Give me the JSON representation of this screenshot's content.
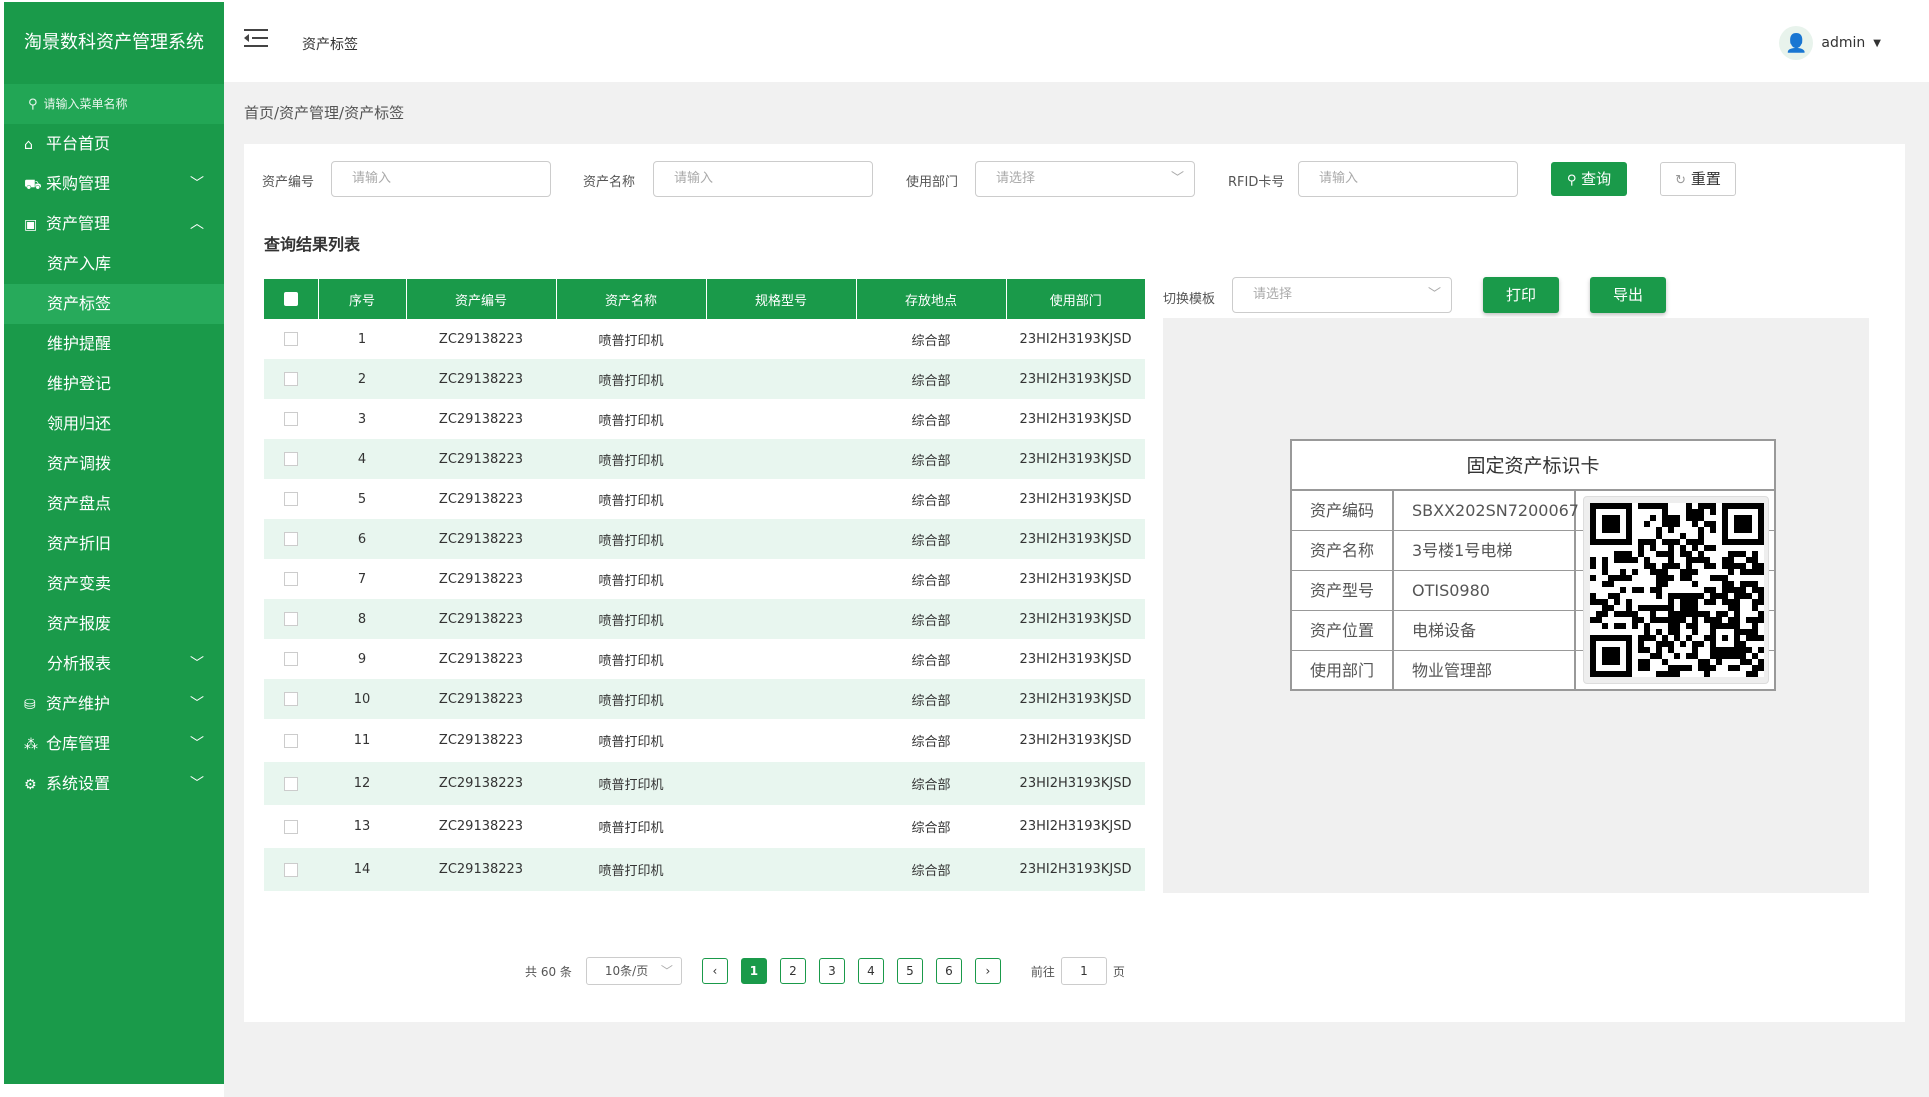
{
  "colors": {
    "brand": "#1a9a4a",
    "row_alt": "#e8f6ef"
  },
  "app": {
    "title": "淘景数科资产管理系统"
  },
  "sidebar": {
    "search_placeholder": "请输入菜单名称",
    "menu": [
      {
        "label": "平台首页",
        "icon": "home-icon"
      },
      {
        "label": "采购管理",
        "icon": "cart-icon",
        "expanded": false
      },
      {
        "label": "资产管理",
        "icon": "monitor-icon",
        "expanded": true
      }
    ],
    "asset_submenu": [
      "资产入库",
      "资产标签",
      "维护提醒",
      "维护登记",
      "领用归还",
      "资产调拨",
      "资产盘点",
      "资产折旧",
      "资产变卖",
      "资产报废",
      "分析报表"
    ],
    "active_submenu": "资产标签",
    "menu_after": [
      {
        "label": "资产维护",
        "icon": "database-icon"
      },
      {
        "label": "仓库管理",
        "icon": "warehouse-icon"
      },
      {
        "label": "系统设置",
        "icon": "gear-icon"
      }
    ]
  },
  "header": {
    "page_title": "资产标签",
    "user": "admin"
  },
  "breadcrumb": "首页/资产管理/资产标签",
  "filters": {
    "asset_code_label": "资产编号",
    "asset_code_placeholder": "请输入",
    "asset_name_label": "资产名称",
    "asset_name_placeholder": "请输入",
    "dept_label": "使用部门",
    "dept_placeholder": "请选择",
    "rfid_label": "RFID卡号",
    "rfid_placeholder": "请输入",
    "query_button": "查询",
    "reset_button": "重置"
  },
  "results_title": "查询结果列表",
  "table": {
    "columns": [
      "序号",
      "资产编号",
      "资产名称",
      "规格型号",
      "存放地点",
      "使用部门"
    ],
    "rows": [
      [
        "1",
        "ZC29138223",
        "喷普打印机",
        "",
        "综合部",
        "23HI2H3193KJSD"
      ],
      [
        "2",
        "ZC29138223",
        "喷普打印机",
        "",
        "综合部",
        "23HI2H3193KJSD"
      ],
      [
        "3",
        "ZC29138223",
        "喷普打印机",
        "",
        "综合部",
        "23HI2H3193KJSD"
      ],
      [
        "4",
        "ZC29138223",
        "喷普打印机",
        "",
        "综合部",
        "23HI2H3193KJSD"
      ],
      [
        "5",
        "ZC29138223",
        "喷普打印机",
        "",
        "综合部",
        "23HI2H3193KJSD"
      ],
      [
        "6",
        "ZC29138223",
        "喷普打印机",
        "",
        "综合部",
        "23HI2H3193KJSD"
      ],
      [
        "7",
        "ZC29138223",
        "喷普打印机",
        "",
        "综合部",
        "23HI2H3193KJSD"
      ],
      [
        "8",
        "ZC29138223",
        "喷普打印机",
        "",
        "综合部",
        "23HI2H3193KJSD"
      ],
      [
        "9",
        "ZC29138223",
        "喷普打印机",
        "",
        "综合部",
        "23HI2H3193KJSD"
      ],
      [
        "10",
        "ZC29138223",
        "喷普打印机",
        "",
        "综合部",
        "23HI2H3193KJSD"
      ],
      [
        "11",
        "ZC29138223",
        "喷普打印机",
        "",
        "综合部",
        "23HI2H3193KJSD"
      ],
      [
        "12",
        "ZC29138223",
        "喷普打印机",
        "",
        "综合部",
        "23HI2H3193KJSD"
      ],
      [
        "13",
        "ZC29138223",
        "喷普打印机",
        "",
        "综合部",
        "23HI2H3193KJSD"
      ],
      [
        "14",
        "ZC29138223",
        "喷普打印机",
        "",
        "综合部",
        "23HI2H3193KJSD"
      ]
    ]
  },
  "print_panel": {
    "template_label": "切换模板",
    "template_placeholder": "请选择",
    "print_button": "打印",
    "export_button": "导出"
  },
  "card": {
    "title": "固定资产标识卡",
    "rows": [
      {
        "key": "资产编码",
        "value": "SBXX202SN7200067"
      },
      {
        "key": "资产名称",
        "value": "3号楼1号电梯"
      },
      {
        "key": "资产型号",
        "value": "OTIS0980"
      },
      {
        "key": "资产位置",
        "value": "电梯设备"
      },
      {
        "key": "使用部门",
        "value": "物业管理部"
      }
    ]
  },
  "pagination": {
    "total_text": "共 60 条",
    "page_size": "10条/页",
    "pages": [
      "1",
      "2",
      "3",
      "4",
      "5",
      "6"
    ],
    "current": "1",
    "prev": "‹",
    "next": "›",
    "goto_label": "前往",
    "goto_value": "1",
    "goto_suffix": "页"
  }
}
